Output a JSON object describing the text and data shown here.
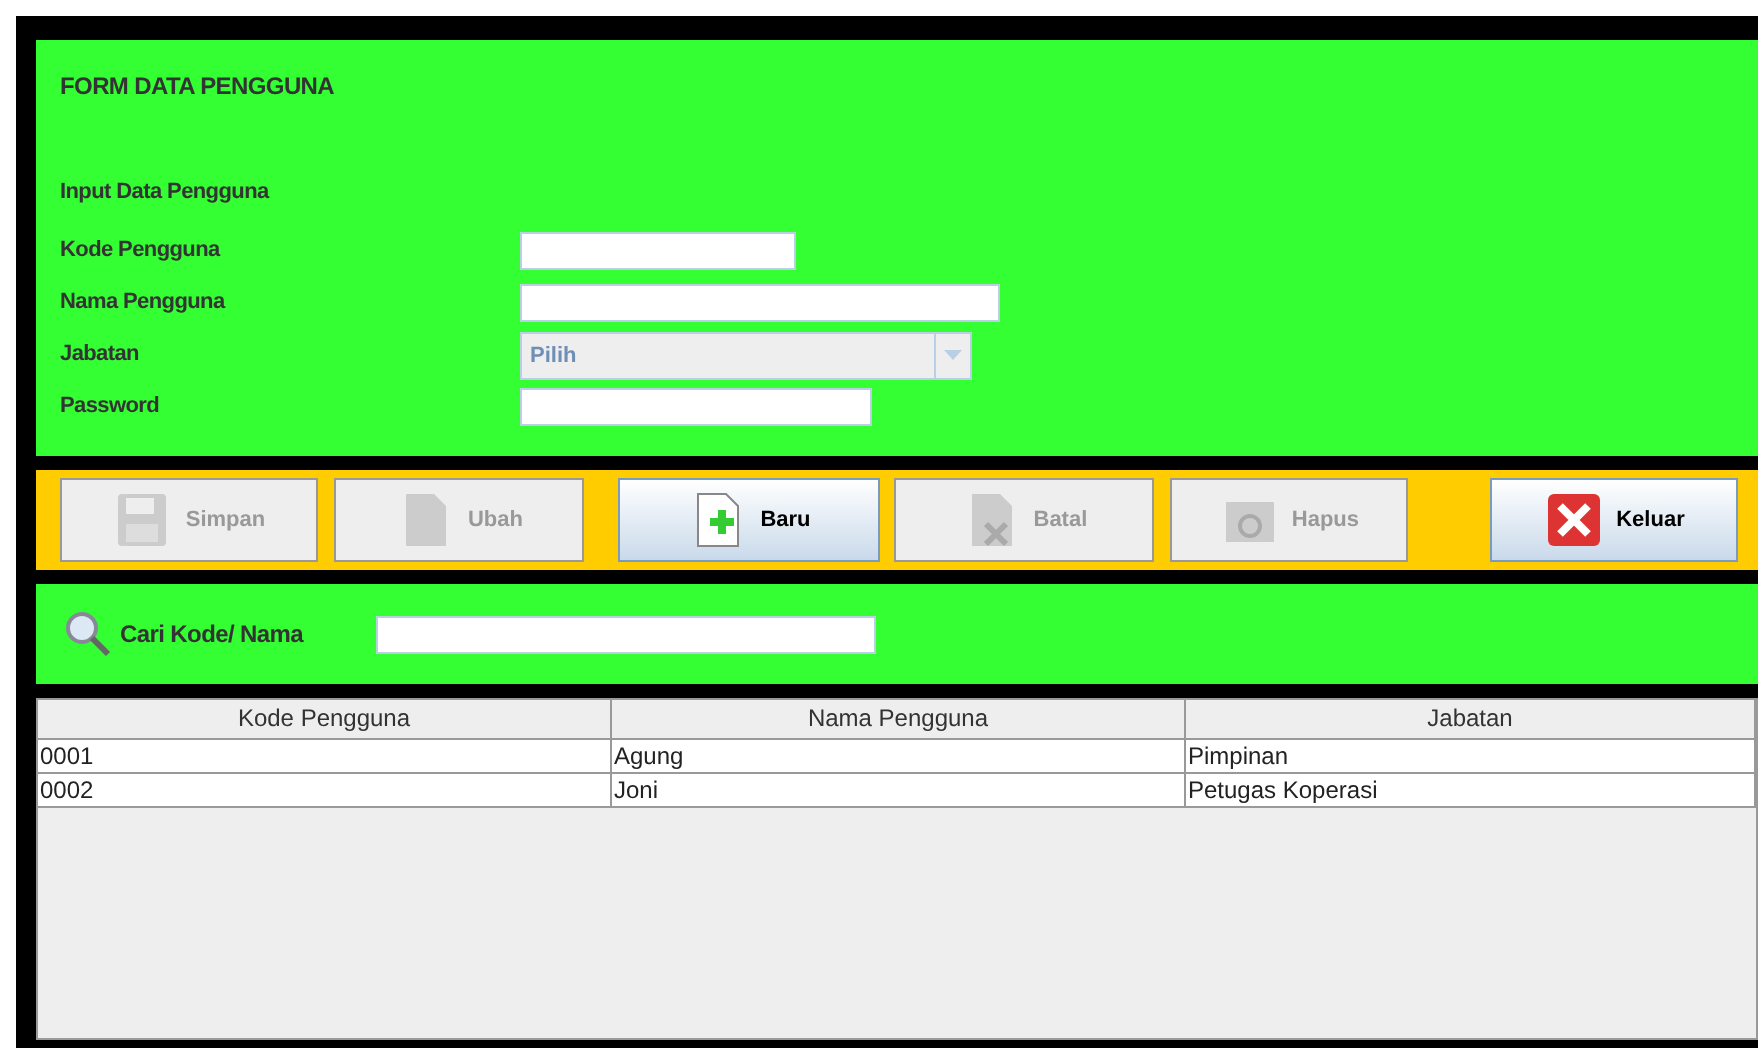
{
  "form": {
    "title": "FORM DATA PENGGUNA",
    "section": "Input Data Pengguna",
    "fields": [
      {
        "label": "Kode Pengguna",
        "kind": "text"
      },
      {
        "label": "Nama Pengguna",
        "kind": "text"
      },
      {
        "label": "Jabatan",
        "kind": "select",
        "value": "Pilih",
        "disabled": true
      },
      {
        "label": "Password",
        "kind": "text"
      }
    ]
  },
  "buttons": [
    {
      "label": "Simpan",
      "disabled": true
    },
    {
      "label": "Ubah",
      "disabled": true
    },
    {
      "label": "Baru",
      "disabled": false
    },
    {
      "label": "Batal",
      "disabled": true
    },
    {
      "label": "Hapus",
      "disabled": true
    },
    {
      "label": "Keluar",
      "disabled": false
    }
  ],
  "search": {
    "label": "Cari Kode/ Nama"
  },
  "table": {
    "columns": [
      "Kode Pengguna",
      "Nama Pengguna",
      "Jabatan"
    ],
    "rows": [
      [
        "0001",
        "Agung",
        "Pimpinan"
      ],
      [
        "0002",
        "Joni",
        "Petugas Koperasi"
      ]
    ]
  }
}
